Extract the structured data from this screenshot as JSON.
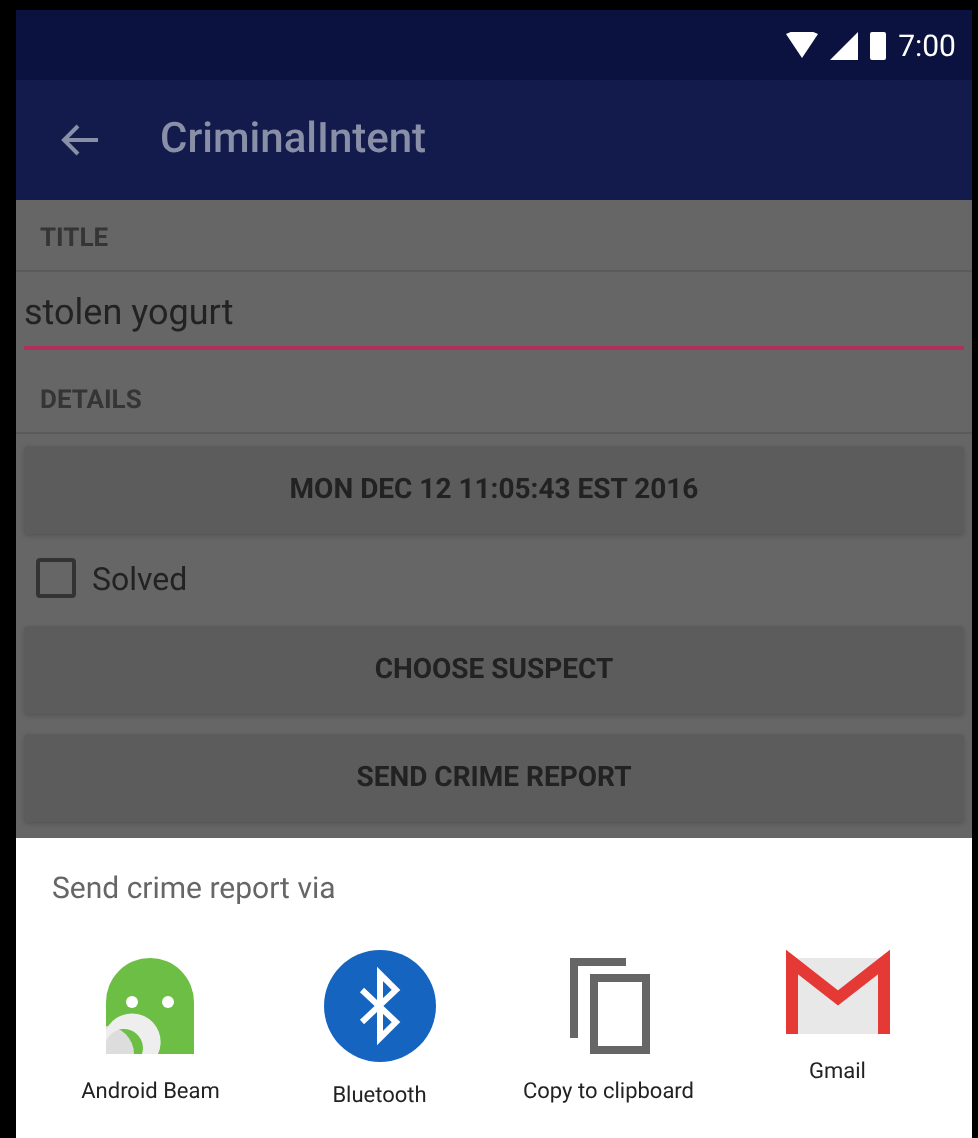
{
  "status_bar": {
    "time": "7:00"
  },
  "toolbar": {
    "title": "CriminalIntent"
  },
  "form": {
    "title_label": "TITLE",
    "title_value": "stolen yogurt",
    "details_label": "DETAILS",
    "date_button": "MON DEC 12 11:05:43 EST 2016",
    "solved": {
      "label": "Solved",
      "checked": false
    },
    "suspect_button": "CHOOSE SUSPECT",
    "report_button": "SEND CRIME REPORT"
  },
  "share_sheet": {
    "title": "Send crime report via",
    "apps": [
      {
        "kind": "beam",
        "label": "Android Beam"
      },
      {
        "kind": "bluetooth",
        "label": "Bluetooth"
      },
      {
        "kind": "clipboard",
        "label": "Copy to clipboard"
      },
      {
        "kind": "gmail",
        "label": "Gmail"
      }
    ]
  }
}
